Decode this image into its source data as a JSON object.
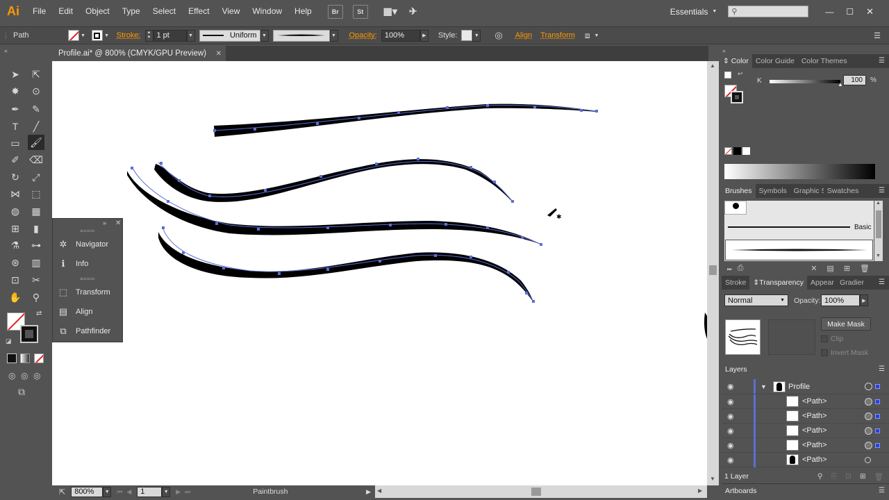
{
  "app": {
    "logo": "Ai",
    "menus": [
      "File",
      "Edit",
      "Object",
      "Type",
      "Select",
      "Effect",
      "View",
      "Window",
      "Help"
    ],
    "bridge_btn": "Br",
    "stock_btn": "St",
    "workspace": "Essentials",
    "search_placeholder": ""
  },
  "control_bar": {
    "selection_type": "Path",
    "stroke_label": "Stroke:",
    "stroke_weight": "1 pt",
    "variable_width": "Uniform",
    "opacity_label": "Opacity:",
    "opacity_value": "100%",
    "style_label": "Style:",
    "align_label": "Align",
    "transform_label": "Transform"
  },
  "document": {
    "tab_title": "Profile.ai* @ 800% (CMYK/GPU Preview)",
    "close_glyph": "✕"
  },
  "status_bar": {
    "zoom": "800%",
    "artboard_number": "1",
    "current_tool": "Paintbrush"
  },
  "float_panel": {
    "items": [
      {
        "label": "Navigator",
        "icon": "navigator-icon",
        "glyph": "✲"
      },
      {
        "label": "Info",
        "icon": "info-icon",
        "glyph": "ℹ"
      },
      {
        "label": "Transform",
        "icon": "transform-icon",
        "glyph": "⬚"
      },
      {
        "label": "Align",
        "icon": "align-icon",
        "glyph": "▤"
      },
      {
        "label": "Pathfinder",
        "icon": "pathfinder-icon",
        "glyph": "⧉"
      }
    ]
  },
  "color_panel": {
    "tabs": [
      "Color",
      "Color Guide",
      "Color Themes"
    ],
    "channel_label": "K",
    "channel_value": "100",
    "percent": "%",
    "k_fraction": 1.0
  },
  "brushes_panel": {
    "tabs": [
      "Brushes",
      "Symbols",
      "Graphic S",
      "Swatches"
    ],
    "brush_name": "Basic"
  },
  "transparency_panel": {
    "tabs": [
      "Stroke",
      "Transparency",
      "Appear",
      "Gradier"
    ],
    "blend_mode": "Normal",
    "opacity_label": "Opacity:",
    "opacity_value": "100%",
    "make_mask": "Make Mask",
    "clip": "Clip",
    "invert_mask": "Invert Mask"
  },
  "layers_panel": {
    "title": "Layers",
    "rows": [
      {
        "name": "Profile",
        "kind": "layer"
      },
      {
        "name": "<Path>",
        "kind": "path"
      },
      {
        "name": "<Path>",
        "kind": "path"
      },
      {
        "name": "<Path>",
        "kind": "path"
      },
      {
        "name": "<Path>",
        "kind": "path"
      },
      {
        "name": "<Path>",
        "kind": "silhouette"
      }
    ],
    "footer_count": "1 Layer"
  },
  "artboards_panel": {
    "title": "Artboards"
  },
  "colors": {
    "accent_orange": "#ff9a00",
    "anchor_blue": "#5a6fd6",
    "selection_blue": "#2a3fe0"
  }
}
